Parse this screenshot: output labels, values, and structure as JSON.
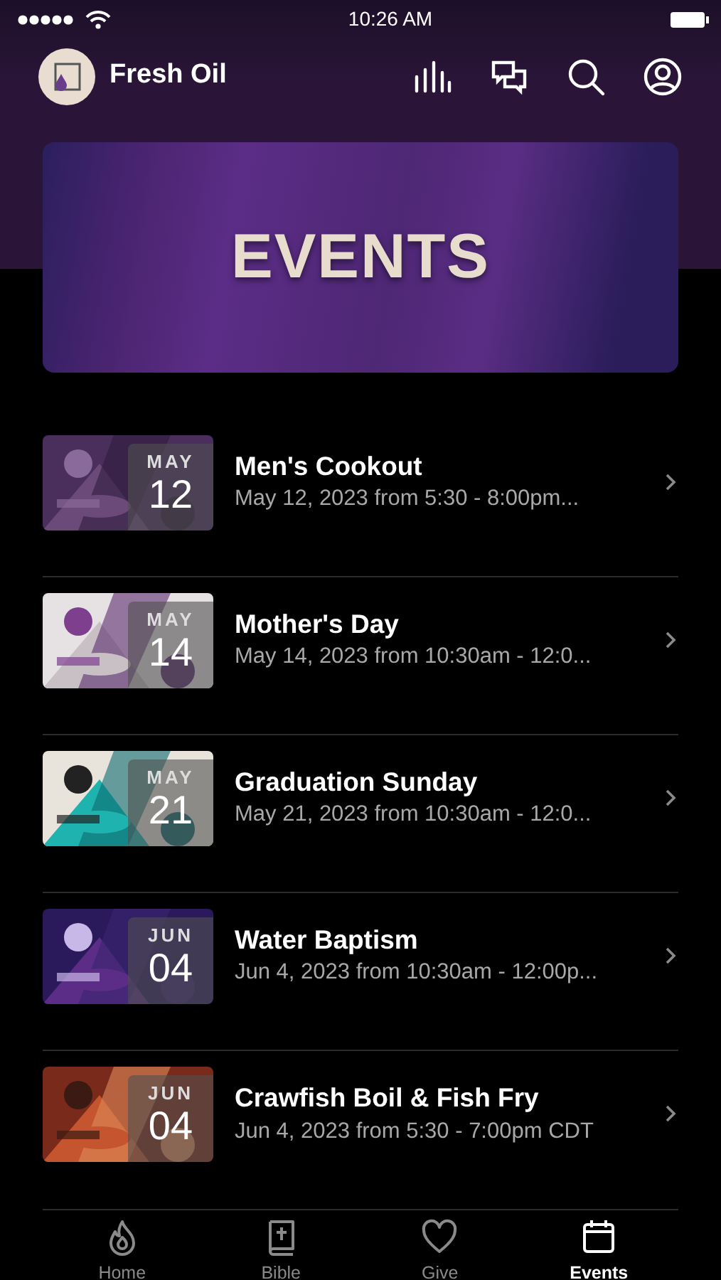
{
  "status_bar": {
    "time": "10:26 AM"
  },
  "header": {
    "title": "Fresh Oil"
  },
  "banner": {
    "title": "EVENTS"
  },
  "events": [
    {
      "month": "MAY",
      "day": "12",
      "title": "Men's Cookout",
      "subtitle": "May 12, 2023 from 5:30 - 8:00pm..."
    },
    {
      "month": "MAY",
      "day": "14",
      "title": "Mother's Day",
      "subtitle": "May 14, 2023 from 10:30am - 12:0..."
    },
    {
      "month": "MAY",
      "day": "21",
      "title": "Graduation Sunday",
      "subtitle": "May 21, 2023 from 10:30am - 12:0..."
    },
    {
      "month": "JUN",
      "day": "04",
      "title": "Water Baptism",
      "subtitle": "Jun 4, 2023 from 10:30am - 12:00p..."
    },
    {
      "month": "JUN",
      "day": "04",
      "title": "Crawfish Boil & Fish Fry",
      "subtitle": "Jun 4, 2023 from 5:30 - 7:00pm CDT"
    }
  ],
  "tab_bar": [
    {
      "kind": "home",
      "label": "Home",
      "selected": false
    },
    {
      "kind": "bible",
      "label": "Bible",
      "selected": false
    },
    {
      "kind": "give",
      "label": "Give",
      "selected": false
    },
    {
      "kind": "events",
      "label": "Events",
      "selected": true
    }
  ]
}
